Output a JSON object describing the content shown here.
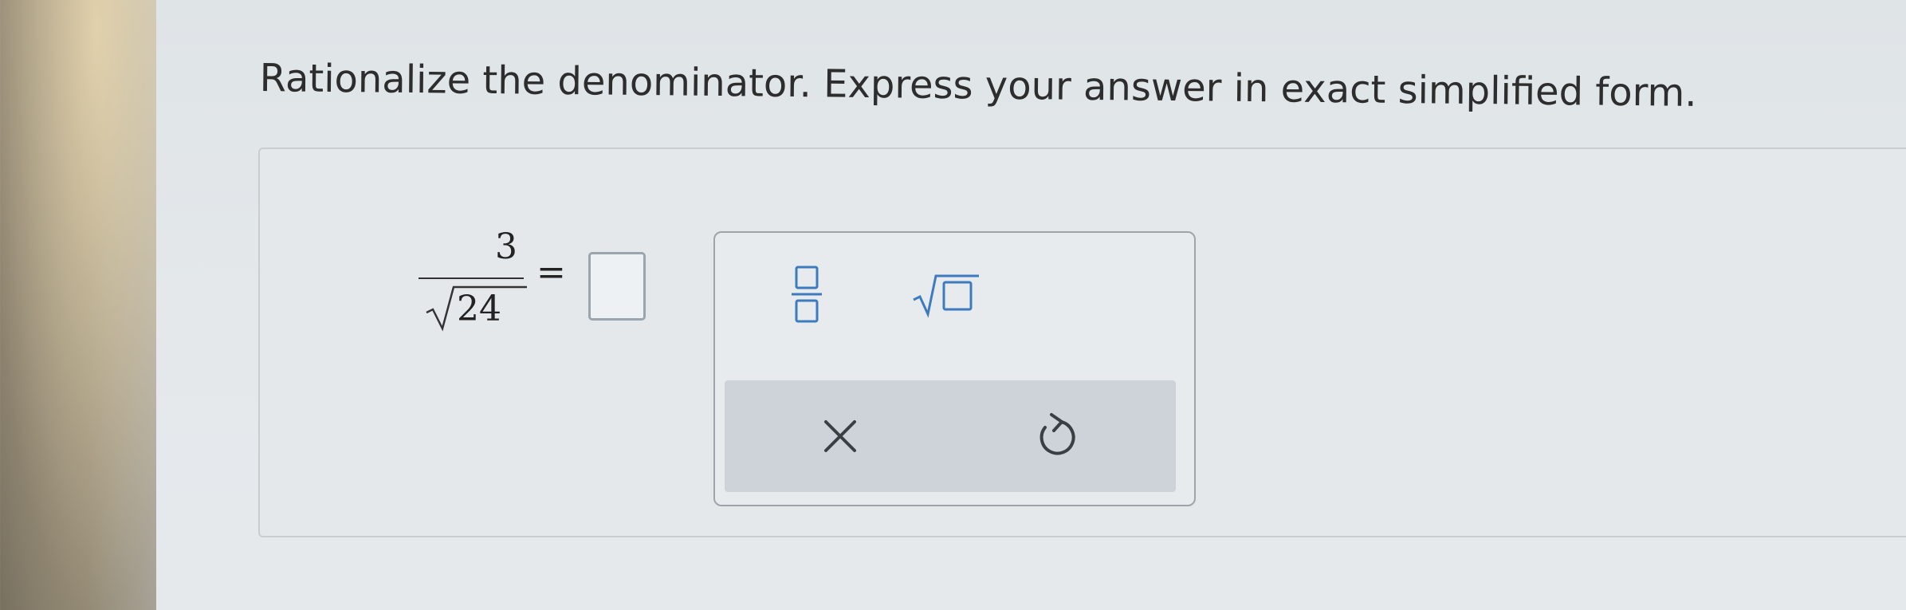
{
  "instruction": "Rationalize the denominator. Express your answer in exact simplified form.",
  "problem": {
    "numerator": "3",
    "radicand": "24",
    "equals": "="
  },
  "keypad": {
    "keys": [
      {
        "icon": "fraction-template-icon"
      },
      {
        "icon": "square-root-template-icon"
      },
      {
        "icon": "close-icon"
      },
      {
        "icon": "undo-icon"
      }
    ]
  }
}
